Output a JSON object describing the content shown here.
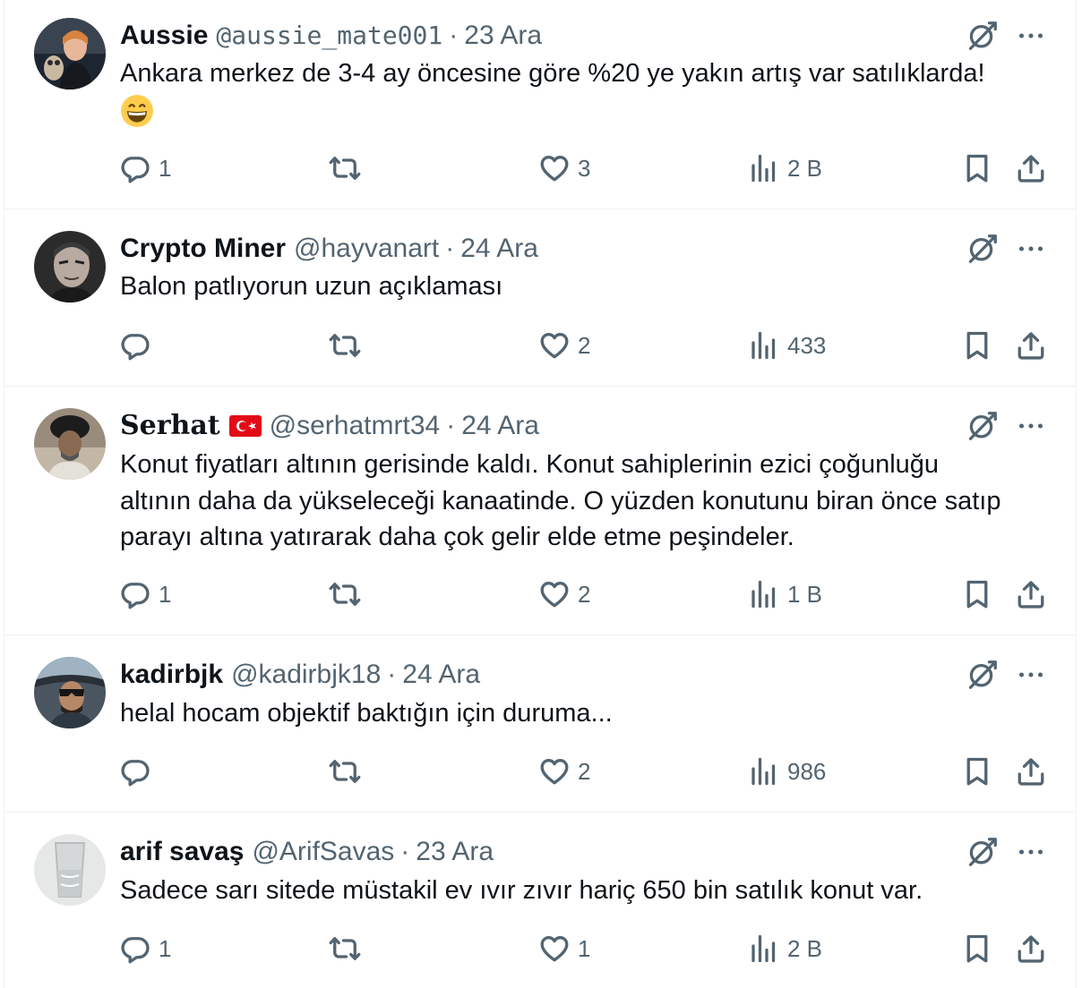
{
  "colors": {
    "text": "#0f1419",
    "secondary": "#536471",
    "divider": "#eff3f4"
  },
  "icons": {
    "reply": "reply-icon",
    "retweet": "retweet-icon",
    "like": "heart-icon",
    "views": "views-bar-icon",
    "bookmark": "bookmark-icon",
    "share": "share-icon",
    "grok": "grok-icon",
    "more": "more-icon"
  },
  "tweets": [
    {
      "name": "Aussie",
      "handle": "@aussie_mate001",
      "separator": "·",
      "date": "23 Ara",
      "text": "Ankara merkez de 3-4 ay öncesine göre %20 ye yakın artış var satılıklarda!",
      "emoji": "grinning-face-emoji",
      "replies": "1",
      "retweets": "",
      "likes": "3",
      "views": "2 B"
    },
    {
      "name": "Crypto Miner",
      "handle": "@hayvanart",
      "separator": "·",
      "date": "24 Ara",
      "text": "Balon patlıyorun uzun açıklaması",
      "replies": "",
      "retweets": "",
      "likes": "2",
      "views": "433"
    },
    {
      "name": "Serhat",
      "flag": "turkey-flag-emoji",
      "handle": "@serhatmrt34",
      "separator": "·",
      "date": "24 Ara",
      "text": "Konut fiyatları altının gerisinde kaldı. Konut sahiplerinin ezici çoğunluğu altının daha da yükseleceği kanaatinde. O yüzden konutunu biran önce satıp parayı altına yatırarak daha çok gelir elde etme peşindeler.",
      "replies": "1",
      "retweets": "",
      "likes": "2",
      "views": "1 B"
    },
    {
      "name": "kadirbjk",
      "handle": "@kadirbjk18",
      "separator": "·",
      "date": "24 Ara",
      "text": "helal hocam objektif baktığın için duruma...",
      "replies": "",
      "retweets": "",
      "likes": "2",
      "views": "986"
    },
    {
      "name": "arif savaş",
      "handle": "@ArifSavas",
      "separator": "·",
      "date": "23 Ara",
      "text": "Sadece sarı sitede müstakil ev ıvır zıvır hariç 650 bin satılık konut var.",
      "replies": "1",
      "retweets": "",
      "likes": "1",
      "views": "2 B"
    }
  ]
}
